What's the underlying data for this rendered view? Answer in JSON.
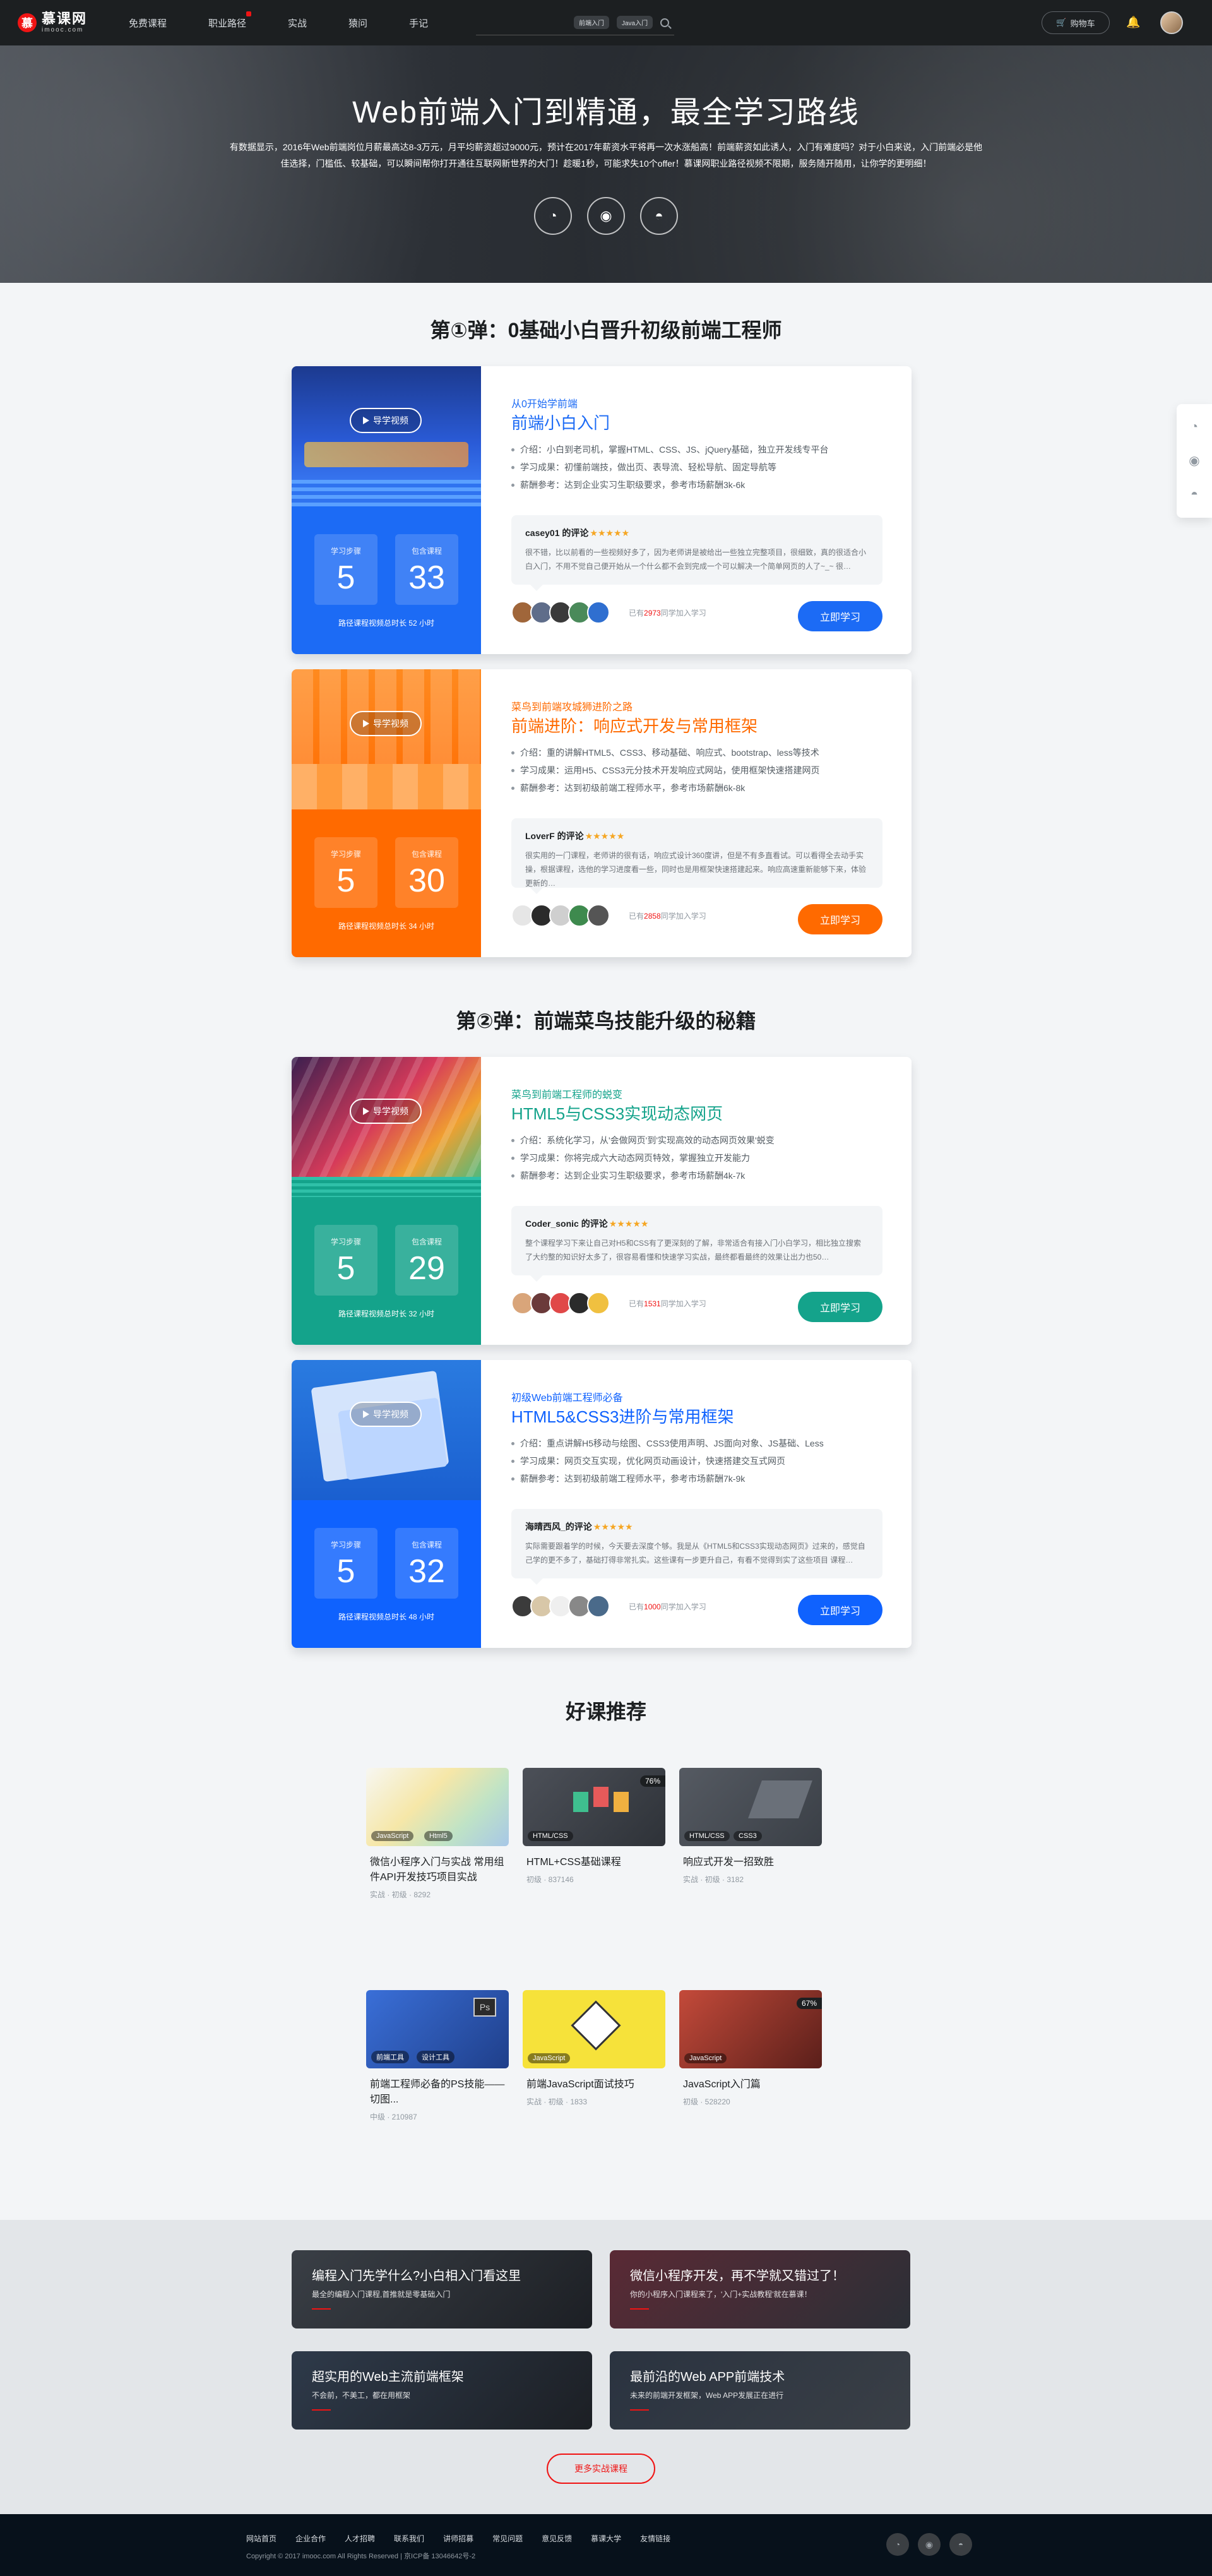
{
  "header": {
    "logo_cn": "慕课网",
    "logo_en": "imooc.com",
    "nav": [
      "免费课程",
      "职业路径",
      "实战",
      "猿问",
      "手记"
    ],
    "search_tags": [
      "前端入门",
      "Java入门"
    ],
    "cart_label": "购物车"
  },
  "hero": {
    "title": "Web前端入门到精通，最全学习路线",
    "desc": "有数据显示，2016年Web前端岗位月薪最高达8-3万元，月平均薪资超过9000元，预计在2017年薪资水平将再一次水涨船高！前端薪资如此诱人，入门有难度吗？对于小白来说，入门前端必是他佳选择，门槛低、较基础，可以瞬间帮你打开通往互联网新世界的大门！趁暖1秒，可能求失10个offer！慕课网职业路径视频不限期，服务随开随用，让你学的更明细！"
  },
  "sections": [
    "第①弹：0基础小白晋升初级前端工程师",
    "第②弹：前端菜鸟技能升级的秘籍",
    "好课推荐"
  ],
  "courses": [
    {
      "guide": "导学视频",
      "steps_label": "学习步骤",
      "steps": "5",
      "courses_label": "包含课程",
      "count": "33",
      "duration": "路径课程视频总时长 52 小时",
      "sub": "从0开始学前端",
      "title": "前端小白入门",
      "points": [
        "介绍：小白到老司机，掌握HTML、CSS、JS、jQuery基础，独立开发线专平台",
        "学习成果：初懂前端技，做出页、表导流、轻松导航、固定导航等",
        "薪酬参考：达到企业实习生职级要求，参考市场薪酬3k-6k"
      ],
      "commenter": "casey01 的评论",
      "stars": "★★★★★",
      "comment": "很不错，比以前看的一些视频好多了，因为老师讲是被给出一些独立完整项目，很细致，真的很适合小白入门，不用不觉自己便开始从一个什么都不会到完成一个可以解决一个简单网页的人了~_~ 很…",
      "joined_pre": "已有",
      "joined_num": "2973",
      "joined_post": "同学加入学习",
      "btn": "立即学习"
    },
    {
      "guide": "导学视频",
      "steps_label": "学习步骤",
      "steps": "5",
      "courses_label": "包含课程",
      "count": "30",
      "duration": "路径课程视频总时长 34 小时",
      "sub": "菜鸟到前端攻城狮进阶之路",
      "title": "前端进阶：响应式开发与常用框架",
      "points": [
        "介绍：重的讲解HTML5、CSS3、移动基础、响应式、bootstrap、less等技术",
        "学习成果：运用H5、CSS3元分技术开发响应式网站，使用框架快速搭建网页",
        "薪酬参考：达到初级前端工程师水平，参考市场薪酬6k-8k"
      ],
      "commenter": "LoverF 的评论",
      "stars": "★★★★★",
      "comment": "很实用的一门课程，老师讲的很有话，响应式设计360度讲，但是不有多直看试。可以看得全去动手实操，根据课程，选他的学习进度看一些，同时也是用框架快速搭建起来。响应高速重新能够下来，体验更新的…",
      "joined_pre": "已有",
      "joined_num": "2858",
      "joined_post": "同学加入学习",
      "btn": "立即学习"
    },
    {
      "guide": "导学视频",
      "steps_label": "学习步骤",
      "steps": "5",
      "courses_label": "包含课程",
      "count": "29",
      "duration": "路径课程视频总时长 32 小时",
      "sub": "菜鸟到前端工程师的蜕变",
      "title": "HTML5与CSS3实现动态网页",
      "points": [
        "介绍：系统化学习，从'会做网页'到'实现高效的动态网页效果'蜕变",
        "学习成果：你将完成六大动态网页特效，掌握独立开发能力",
        "薪酬参考：达到企业实习生职级要求，参考市场薪酬4k-7k"
      ],
      "commenter": "Coder_sonic 的评论",
      "stars": "★★★★★",
      "comment": "整个课程学习下来让自己对H5和CSS有了更深刻的了解，非常适合有接入门小白学习，相比独立搜索了大约整的知识好太多了，很容易看懂和快速学习实战，最终都看最终的效果让出力也50…",
      "joined_pre": "已有",
      "joined_num": "1531",
      "joined_post": "同学加入学习",
      "btn": "立即学习"
    },
    {
      "guide": "导学视频",
      "steps_label": "学习步骤",
      "steps": "5",
      "courses_label": "包含课程",
      "count": "32",
      "duration": "路径课程视频总时长 48 小时",
      "sub": "初级Web前端工程师必备",
      "title": "HTML5&CSS3进阶与常用框架",
      "points": [
        "介绍：重点讲解H5移动与绘图、CSS3使用声明、JS面向对象、JS基础、Less",
        "学习成果：网页交互实现，优化网页动画设计，快速搭建交互式网页",
        "薪酬参考：达到初级前端工程师水平，参考市场薪酬7k-9k"
      ],
      "commenter": "海晴西风_的评论",
      "stars": "★★★★★",
      "comment": "实际需要跟着学的时候，今天要去深度个够。我是从《HTML5和CSS3实现动态网页》过来的，感觉自己学的更不多了，基础打得非常扎实。这些课有一步更升自己，有看不觉得到实了这些项目 课程…",
      "joined_pre": "已有",
      "joined_num": "1000",
      "joined_post": "同学加入学习",
      "btn": "立即学习"
    }
  ],
  "recommend": [
    {
      "name": "微信小程序入门与实战 常用组件API开发技巧项目实战",
      "meta": "实战 · 初级 · 8292",
      "tags": [
        "JavaScript",
        "Html5"
      ],
      "pct": ""
    },
    {
      "name": "HTML+CSS基础课程",
      "meta": "初级 · 837146",
      "tags": [
        "HTML/CSS"
      ],
      "pct": "76%"
    },
    {
      "name": "响应式开发一招致胜",
      "meta": "实战 · 初级 · 3182",
      "tags": [
        "HTML/CSS",
        "CSS3"
      ],
      "pct": ""
    },
    {
      "name": "前端工程师必备的PS技能——切图...",
      "meta": "中级 · 210987",
      "tags": [
        "前端工具",
        "设计工具"
      ],
      "pct": ""
    },
    {
      "name": "前端JavaScript面试技巧",
      "meta": "实战 · 初级 · 1833",
      "tags": [
        "JavaScript"
      ],
      "pct": ""
    },
    {
      "name": "JavaScript入门篇",
      "meta": "初级 · 528220",
      "tags": [
        "JavaScript"
      ],
      "pct": "67%"
    }
  ],
  "practice": [
    {
      "title": "编程入门先学什么?小白相入门看这里",
      "desc": "最全的编程入门课程,首推就是零基础入门"
    },
    {
      "title": "微信小程序开发，再不学就又错过了！",
      "desc": "你的小程序入门课程来了，'入门+实战教程'就在慕课！"
    },
    {
      "title": "超实用的Web主流前端框架",
      "desc": "不会前，不美工，都在用框架"
    },
    {
      "title": "最前沿的Web APP前端技术",
      "desc": "未来的前端开发框架，Web APP发展正在进行"
    }
  ],
  "more_btn": "更多实战课程",
  "footer": {
    "links": [
      "网站首页",
      "企业合作",
      "人才招聘",
      "联系我们",
      "讲师招募",
      "常见问题",
      "意见反馈",
      "慕课大学",
      "友情链接"
    ],
    "copyright": "Copyright © 2017 imooc.com All Rights Reserved | 京ICP备 13046642号-2"
  },
  "colors": {
    "blue": "#0f62fe",
    "orange": "#ff6a00",
    "teal": "#14a38b",
    "red": "#f01414"
  }
}
